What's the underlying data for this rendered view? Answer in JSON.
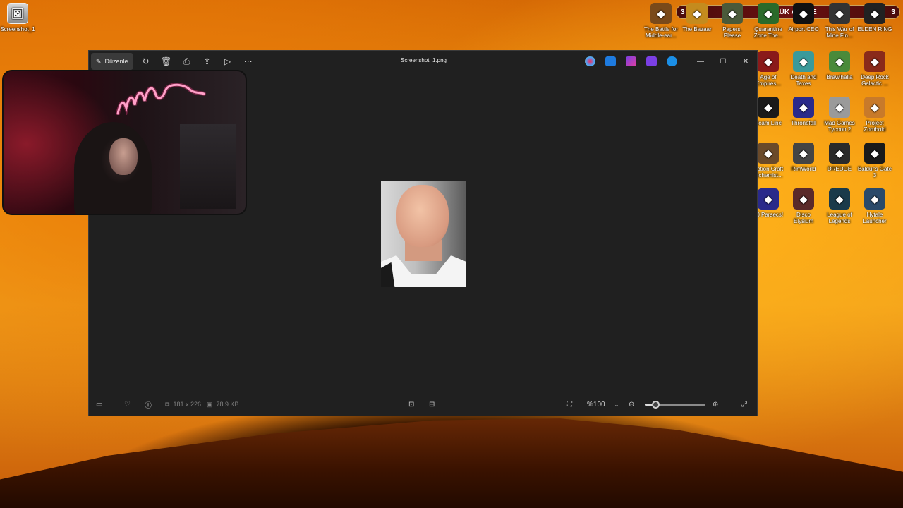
{
  "desktop": {
    "top_left_icon": {
      "label": "Screenshot_1",
      "icon": "image-file-icon"
    },
    "icons": [
      {
        "label": "The Battle for Middle-ear...",
        "color": "#7a4a1a"
      },
      {
        "label": "The Bazaar",
        "color": "#c48b1e"
      },
      {
        "label": "Papers, Please",
        "color": "#4a5a3a"
      },
      {
        "label": "Quarantine Zone The...",
        "color": "#2a6a2a"
      },
      {
        "label": "Airport CEO",
        "color": "#111111"
      },
      {
        "label": "This War of Mine Fin...",
        "color": "#333333"
      },
      {
        "label": "ELDEN RING",
        "color": "#222222"
      },
      {
        "label": "Age of Empires...",
        "color": "#8a1a1a"
      },
      {
        "label": "Death and Taxes",
        "color": "#3a9a9a"
      },
      {
        "label": "Brawlhalla",
        "color": "#4a8a3a"
      },
      {
        "label": "Deep Rock Galactic ...",
        "color": "#8a2a1a"
      },
      {
        "label": "Scam Line",
        "color": "#1a1a1a"
      },
      {
        "label": "Thronefall",
        "color": "#2a2a8a"
      },
      {
        "label": "Mad Games Tycoon 2",
        "color": "#9a9a9a"
      },
      {
        "label": "Project Zomboid",
        "color": "#c87a2a"
      },
      {
        "label": "Potion Craft Alchemist...",
        "color": "#6a4a2a"
      },
      {
        "label": "RimWorld",
        "color": "#444444"
      },
      {
        "label": "DREDGE",
        "color": "#2a2a2a"
      },
      {
        "label": "Baldur's Gate 3",
        "color": "#1a1a1a"
      },
      {
        "label": "60 Parsecs!",
        "color": "#2a2a8a"
      },
      {
        "label": "Disco Elysium",
        "color": "#5a2a2a"
      },
      {
        "label": "League of Legends",
        "color": "#1a3a4a"
      },
      {
        "label": "Hytale Launcher",
        "color": "#2a4a6a"
      }
    ]
  },
  "banner": {
    "left_count": "3",
    "title": "GÜNLÜK ABONE",
    "right_count": "3"
  },
  "viewer": {
    "edit_label": "Düzenle",
    "file_name": "Screenshot_1.png",
    "dimensions": "181 x 226",
    "file_size": "78.9 KB",
    "zoom": "%100",
    "zoom_fraction": 0.18
  }
}
